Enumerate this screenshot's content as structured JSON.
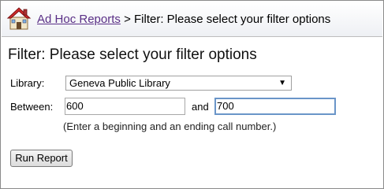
{
  "breadcrumb": {
    "link_label": "Ad Hoc Reports",
    "separator": ">",
    "current": "Filter: Please select your filter options"
  },
  "page": {
    "title": "Filter: Please select your filter options"
  },
  "form": {
    "library_label": "Library:",
    "library_selected": "Geneva Public Library",
    "between_label": "Between:",
    "from_value": "600",
    "and_label": "and",
    "to_value": "700",
    "hint": "(Enter a beginning and an ending call number.)",
    "run_button": "Run Report"
  },
  "icons": {
    "home": "house-icon",
    "dropdown": "chevron-down-icon"
  },
  "colors": {
    "link": "#5a2f86",
    "focus_border": "#6a95c8"
  }
}
